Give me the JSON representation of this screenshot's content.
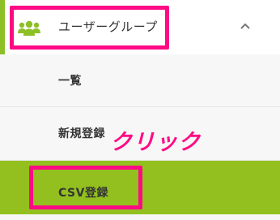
{
  "colors": {
    "accent_green": "#8dbf26",
    "active_item_bg": "#93c01f",
    "highlight_pink": "#ff0a85",
    "submenu_bg": "#f7f7f7"
  },
  "nav_section": {
    "icon": "users-icon",
    "label": "ユーザーグループ",
    "toggle_icon": "chevron-up-icon",
    "expanded": true
  },
  "submenu": {
    "items": [
      {
        "label": "一覧",
        "active": false
      },
      {
        "label": "新規登録",
        "active": false
      },
      {
        "label": "CSV登録",
        "active": true
      }
    ]
  },
  "annotation": {
    "text": "クリック"
  }
}
